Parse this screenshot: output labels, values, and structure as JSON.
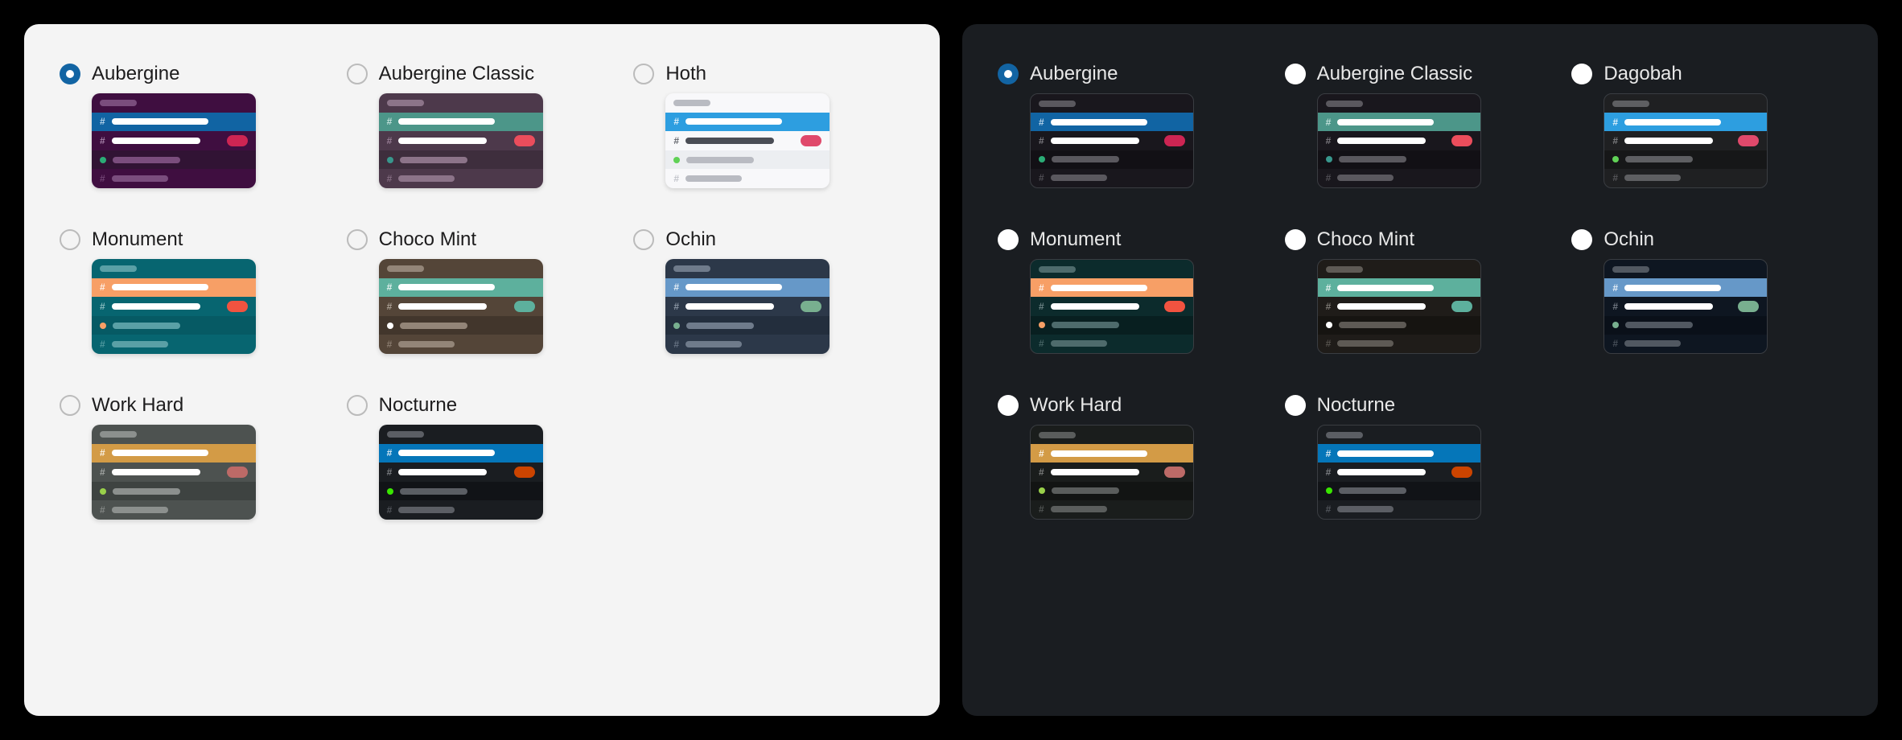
{
  "panels": [
    {
      "mode": "light",
      "themes": [
        {
          "id": "aubergine",
          "label": "Aubergine",
          "selected": true,
          "preview": {
            "bg": "#3f0e40",
            "title_bar": "#7a4d7d",
            "active_bg": "#1164a3",
            "active_hash": "#cfe4f5",
            "active_text": "#ffffff",
            "row_hash": "#b694b9",
            "row_text": "#ffffff",
            "pill": "#cd2553",
            "presence_row_bg": "#311334",
            "dot": "#2bac76",
            "presence_text": "#7a4d7d",
            "last_hash": "#7a4d7d",
            "last_text": "#7a4d7d"
          }
        },
        {
          "id": "aubergine-classic",
          "label": "Aubergine Classic",
          "selected": false,
          "preview": {
            "bg": "#4d394b",
            "title_bar": "#8c7489",
            "active_bg": "#4c9689",
            "active_hash": "#d8eeea",
            "active_text": "#ffffff",
            "row_hash": "#a48ba2",
            "row_text": "#ffffff",
            "pill": "#eb4d5c",
            "presence_row_bg": "#3e2e3d",
            "dot": "#38978d",
            "presence_text": "#8c7489",
            "last_hash": "#8c7489",
            "last_text": "#8c7489"
          }
        },
        {
          "id": "hoth",
          "label": "Hoth",
          "selected": false,
          "preview": {
            "bg": "#f8f8fa",
            "title_bar": "#b9bbc2",
            "active_bg": "#2d9ee0",
            "active_hash": "#ffffff",
            "active_text": "#ffffff",
            "row_hash": "#4a4d55",
            "row_text": "#4a4d55",
            "pill": "#e0496b",
            "presence_row_bg": "#eceef1",
            "dot": "#60d156",
            "presence_text": "#b9bbc2",
            "last_hash": "#b9bbc2",
            "last_text": "#b9bbc2"
          }
        },
        {
          "id": "monument",
          "label": "Monument",
          "selected": false,
          "preview": {
            "bg": "#076570",
            "title_bar": "#5aa0a6",
            "active_bg": "#f79f66",
            "active_hash": "#ffffff",
            "active_text": "#ffffff",
            "row_hash": "#9cc8cb",
            "row_text": "#ffffff",
            "pill": "#f15340",
            "presence_row_bg": "#065a64",
            "dot": "#f79f66",
            "presence_text": "#5aa0a6",
            "last_hash": "#5aa0a6",
            "last_text": "#5aa0a6"
          }
        },
        {
          "id": "choco-mint",
          "label": "Choco Mint",
          "selected": false,
          "preview": {
            "bg": "#544538",
            "title_bar": "#938578",
            "active_bg": "#5db09d",
            "active_hash": "#ffffff",
            "active_text": "#ffffff",
            "row_hash": "#bab0a4",
            "row_text": "#ffffff",
            "pill": "#5db09d",
            "presence_row_bg": "#42362c",
            "dot": "#ffffff",
            "presence_text": "#938578",
            "last_hash": "#938578",
            "last_text": "#938578"
          }
        },
        {
          "id": "ochin",
          "label": "Ochin",
          "selected": false,
          "preview": {
            "bg": "#2c3849",
            "title_bar": "#6f7b8b",
            "active_bg": "#6698c8",
            "active_hash": "#ffffff",
            "active_text": "#ffffff",
            "row_hash": "#9aa5b2",
            "row_text": "#ffffff",
            "pill": "#78af8f",
            "presence_row_bg": "#232e3d",
            "dot": "#78af8f",
            "presence_text": "#6f7b8b",
            "last_hash": "#6f7b8b",
            "last_text": "#6f7b8b"
          }
        },
        {
          "id": "work-hard",
          "label": "Work Hard",
          "selected": false,
          "preview": {
            "bg": "#4d5250",
            "title_bar": "#8c908e",
            "active_bg": "#d39b46",
            "active_hash": "#ffffff",
            "active_text": "#ffffff",
            "row_hash": "#b0b3b1",
            "row_text": "#ffffff",
            "pill": "#bd6a67",
            "presence_row_bg": "#3e4341",
            "dot": "#99d04a",
            "presence_text": "#8c908e",
            "last_hash": "#8c908e",
            "last_text": "#8c908e"
          }
        },
        {
          "id": "nocturne",
          "label": "Nocturne",
          "selected": false,
          "preview": {
            "bg": "#1a1d21",
            "title_bar": "#5b5e64",
            "active_bg": "#0576b9",
            "active_hash": "#ffffff",
            "active_text": "#ffffff",
            "row_hash": "#8c8f94",
            "row_text": "#ffffff",
            "pill": "#cc4400",
            "presence_row_bg": "#111317",
            "dot": "#39e500",
            "presence_text": "#5b5e64",
            "last_hash": "#5b5e64",
            "last_text": "#5b5e64"
          }
        }
      ]
    },
    {
      "mode": "dark",
      "themes": [
        {
          "id": "aubergine-d",
          "label": "Aubergine",
          "selected": true,
          "preview": {
            "bg": "#19171d",
            "title_bar": "#5a585e",
            "active_bg": "#1164a3",
            "active_hash": "#cfe4f5",
            "active_text": "#ffffff",
            "row_hash": "#8c8a90",
            "row_text": "#ffffff",
            "pill": "#cd2553",
            "presence_row_bg": "#121015",
            "dot": "#2bac76",
            "presence_text": "#5a585e",
            "last_hash": "#5a585e",
            "last_text": "#5a585e"
          }
        },
        {
          "id": "aubergine-classic-d",
          "label": "Aubergine Classic",
          "selected": false,
          "preview": {
            "bg": "#19171d",
            "title_bar": "#5a585e",
            "active_bg": "#4c9689",
            "active_hash": "#d8eeea",
            "active_text": "#ffffff",
            "row_hash": "#8c8a90",
            "row_text": "#ffffff",
            "pill": "#eb4d5c",
            "presence_row_bg": "#121015",
            "dot": "#38978d",
            "presence_text": "#5a585e",
            "last_hash": "#5a585e",
            "last_text": "#5a585e"
          }
        },
        {
          "id": "dagobah",
          "label": "Dagobah",
          "selected": false,
          "preview": {
            "bg": "#1f2022",
            "title_bar": "#5e5f62",
            "active_bg": "#2d9ee0",
            "active_hash": "#ffffff",
            "active_text": "#ffffff",
            "row_hash": "#8e8f91",
            "row_text": "#ffffff",
            "pill": "#e0496b",
            "presence_row_bg": "#161718",
            "dot": "#60d156",
            "presence_text": "#5e5f62",
            "last_hash": "#5e5f62",
            "last_text": "#5e5f62"
          }
        },
        {
          "id": "monument-d",
          "label": "Monument",
          "selected": false,
          "preview": {
            "bg": "#0c2b2c",
            "title_bar": "#4e6b6c",
            "active_bg": "#f79f66",
            "active_hash": "#ffffff",
            "active_text": "#ffffff",
            "row_hash": "#7d9394",
            "row_text": "#ffffff",
            "pill": "#f15340",
            "presence_row_bg": "#081f20",
            "dot": "#f79f66",
            "presence_text": "#4e6b6c",
            "last_hash": "#4e6b6c",
            "last_text": "#4e6b6c"
          }
        },
        {
          "id": "choco-mint-d",
          "label": "Choco Mint",
          "selected": false,
          "preview": {
            "bg": "#1f1c19",
            "title_bar": "#5e5a55",
            "active_bg": "#5db09d",
            "active_hash": "#ffffff",
            "active_text": "#ffffff",
            "row_hash": "#8e8a84",
            "row_text": "#ffffff",
            "pill": "#5db09d",
            "presence_row_bg": "#161411",
            "dot": "#ffffff",
            "presence_text": "#5e5a55",
            "last_hash": "#5e5a55",
            "last_text": "#5e5a55"
          }
        },
        {
          "id": "ochin-d",
          "label": "Ochin",
          "selected": false,
          "preview": {
            "bg": "#0e1621",
            "title_bar": "#515861",
            "active_bg": "#6698c8",
            "active_hash": "#ffffff",
            "active_text": "#ffffff",
            "row_hash": "#828992",
            "row_text": "#ffffff",
            "pill": "#78af8f",
            "presence_row_bg": "#0a1019",
            "dot": "#78af8f",
            "presence_text": "#515861",
            "last_hash": "#515861",
            "last_text": "#515861"
          }
        },
        {
          "id": "work-hard-d",
          "label": "Work Hard",
          "selected": false,
          "preview": {
            "bg": "#1a1d1c",
            "title_bar": "#5a5d5c",
            "active_bg": "#d39b46",
            "active_hash": "#ffffff",
            "active_text": "#ffffff",
            "row_hash": "#8b8d8c",
            "row_text": "#ffffff",
            "pill": "#bd6a67",
            "presence_row_bg": "#121413",
            "dot": "#99d04a",
            "presence_text": "#5a5d5c",
            "last_hash": "#5a5d5c",
            "last_text": "#5a5d5c"
          }
        },
        {
          "id": "nocturne-d",
          "label": "Nocturne",
          "selected": false,
          "preview": {
            "bg": "#1a1d21",
            "title_bar": "#5b5e64",
            "active_bg": "#0576b9",
            "active_hash": "#ffffff",
            "active_text": "#ffffff",
            "row_hash": "#8c8f94",
            "row_text": "#ffffff",
            "pill": "#cc4400",
            "presence_row_bg": "#111317",
            "dot": "#39e500",
            "presence_text": "#5b5e64",
            "last_hash": "#5b5e64",
            "last_text": "#5b5e64"
          }
        }
      ]
    }
  ]
}
